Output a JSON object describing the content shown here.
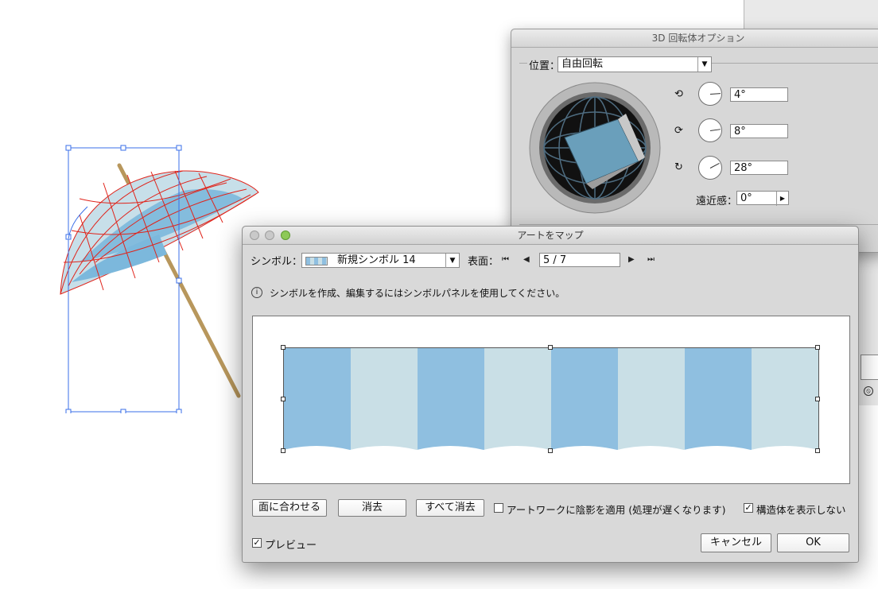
{
  "panel3d": {
    "title": "3D 回転体オプション",
    "position_label": "位置：",
    "position_value": "自由回転",
    "rot_x": "4°",
    "rot_y": "8°",
    "rot_z": "28°",
    "perspective_label": "遠近感：",
    "perspective_value": "0°"
  },
  "dialog": {
    "title": "アートをマップ",
    "symbol_label": "シンボル：",
    "symbol_value": "新規シンボル 14",
    "surface_label": "表面：",
    "surface_value": "5 / 7",
    "info_text": "シンボルを作成、編集するにはシンボルパネルを使用してください。",
    "fit_button": "面に合わせる",
    "clear_button": "消去",
    "clear_all_button": "すべて消去",
    "shade_label": "アートワークに陰影を適用 (処理が遅くなります)",
    "shade_checked": false,
    "hide_geometry_label": "構造体を表示しない",
    "hide_geometry_checked": true,
    "preview_label": "プレビュー",
    "preview_checked": true,
    "cancel_button": "キャンセル",
    "ok_button": "OK"
  },
  "colors": {
    "stripe_dark": "#8fbfe0",
    "stripe_light": "#c9dfe6",
    "wireframe": "#e0241b",
    "selection": "#3a6fe8",
    "cube": "#6a9fbb"
  }
}
